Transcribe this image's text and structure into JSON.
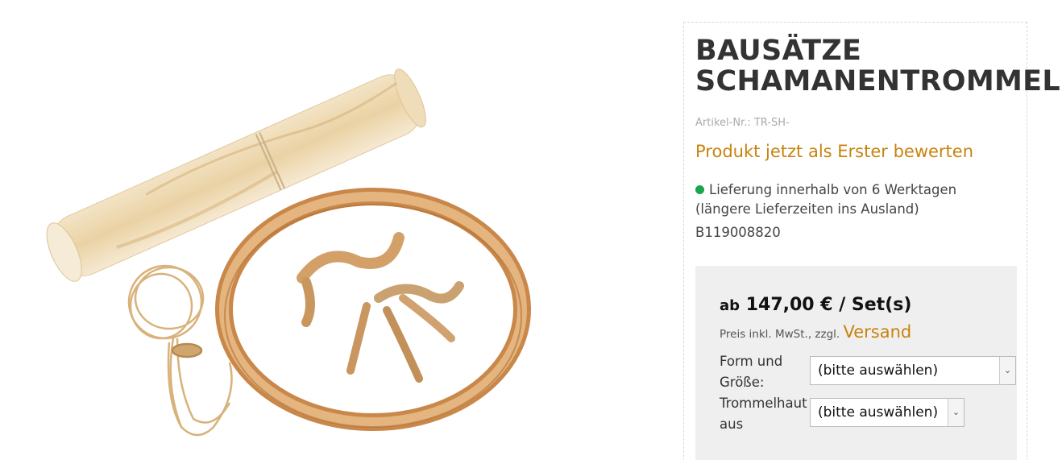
{
  "product": {
    "title_line1": "BAUSÄTZE",
    "title_line2": "SCHAMANENTROMMEL",
    "article_number": "Artikel-Nr.: TR-SH-",
    "rate_link": "Produkt jetzt als Erster bewerten",
    "delivery": "Lieferung innerhalb von 6 Werktagen",
    "delivery_note": "(längere Lieferzeiten ins Ausland)",
    "sku": "B119008820"
  },
  "pricing": {
    "price_prefix": "ab",
    "price": "147,00 € / Set(s)",
    "tax_note": "Preis inkl. MwSt., zzgl.",
    "shipping_link": "Versand"
  },
  "options": {
    "form_label_line1": "Form und",
    "form_label_line2": "Größe:",
    "form_value": "(bitte auswählen)",
    "skin_label_line1": "Trommelhaut",
    "skin_label_line2": "aus",
    "skin_value": "(bitte auswählen)"
  },
  "colors": {
    "accent": "#c8830e",
    "available": "#1aa64b",
    "price_box": "#efefef"
  }
}
